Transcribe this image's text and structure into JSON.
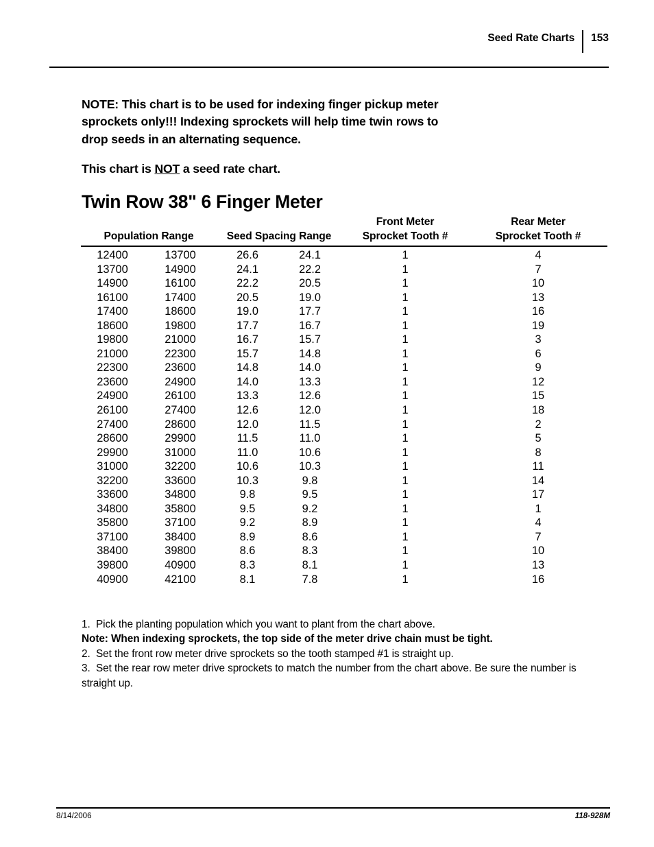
{
  "header": {
    "section_title": "Seed Rate Charts",
    "page_number": "153"
  },
  "note": {
    "line1": "NOTE: This chart is to be used for indexing finger pickup meter",
    "line2": "sprockets only!!! Indexing sprockets will help time twin rows to",
    "line3": "drop seeds in an alternating sequence.",
    "second_prefix": "This chart is ",
    "second_emphasis": "NOT",
    "second_suffix": " a seed rate chart."
  },
  "chart_title": "Twin Row 38\" 6 Finger Meter",
  "table": {
    "group_headers": {
      "population": "Population Range",
      "seed_spacing": "Seed Spacing Range",
      "front_top": "Front Meter",
      "front_bottom": "Sprocket Tooth #",
      "rear_top": "Rear Meter",
      "rear_bottom": "Sprocket Tooth #"
    },
    "rows": [
      [
        "12400",
        "13700",
        "26.6",
        "24.1",
        "1",
        "4"
      ],
      [
        "13700",
        "14900",
        "24.1",
        "22.2",
        "1",
        "7"
      ],
      [
        "14900",
        "16100",
        "22.2",
        "20.5",
        "1",
        "10"
      ],
      [
        "16100",
        "17400",
        "20.5",
        "19.0",
        "1",
        "13"
      ],
      [
        "17400",
        "18600",
        "19.0",
        "17.7",
        "1",
        "16"
      ],
      [
        "18600",
        "19800",
        "17.7",
        "16.7",
        "1",
        "19"
      ],
      [
        "19800",
        "21000",
        "16.7",
        "15.7",
        "1",
        "3"
      ],
      [
        "21000",
        "22300",
        "15.7",
        "14.8",
        "1",
        "6"
      ],
      [
        "22300",
        "23600",
        "14.8",
        "14.0",
        "1",
        "9"
      ],
      [
        "23600",
        "24900",
        "14.0",
        "13.3",
        "1",
        "12"
      ],
      [
        "24900",
        "26100",
        "13.3",
        "12.6",
        "1",
        "15"
      ],
      [
        "26100",
        "27400",
        "12.6",
        "12.0",
        "1",
        "18"
      ],
      [
        "27400",
        "28600",
        "12.0",
        "11.5",
        "1",
        "2"
      ],
      [
        "28600",
        "29900",
        "11.5",
        "11.0",
        "1",
        "5"
      ],
      [
        "29900",
        "31000",
        "11.0",
        "10.6",
        "1",
        "8"
      ],
      [
        "31000",
        "32200",
        "10.6",
        "10.3",
        "1",
        "11"
      ],
      [
        "32200",
        "33600",
        "10.3",
        "9.8",
        "1",
        "14"
      ],
      [
        "33600",
        "34800",
        "9.8",
        "9.5",
        "1",
        "17"
      ],
      [
        "34800",
        "35800",
        "9.5",
        "9.2",
        "1",
        "1"
      ],
      [
        "35800",
        "37100",
        "9.2",
        "8.9",
        "1",
        "4"
      ],
      [
        "37100",
        "38400",
        "8.9",
        "8.6",
        "1",
        "7"
      ],
      [
        "38400",
        "39800",
        "8.6",
        "8.3",
        "1",
        "10"
      ],
      [
        "39800",
        "40900",
        "8.3",
        "8.1",
        "1",
        "13"
      ],
      [
        "40900",
        "42100",
        "8.1",
        "7.8",
        "1",
        "16"
      ]
    ]
  },
  "instructions": [
    {
      "number": "1.",
      "text": "Pick the planting population which you want to plant from the chart above.",
      "bold": false
    },
    {
      "number": "",
      "text": "Note: When indexing sprockets, the top side of the meter drive chain must be tight.",
      "bold": true
    },
    {
      "number": "2.",
      "text": "Set the front row meter drive sprockets so the tooth stamped #1 is straight up.",
      "bold": false
    },
    {
      "number": "3.",
      "text": "Set the rear row meter drive sprockets to match the number from the chart above. Be sure the number is straight up.",
      "bold": false
    }
  ],
  "footer": {
    "date": "8/14/2006",
    "document_code": "118-928M"
  }
}
